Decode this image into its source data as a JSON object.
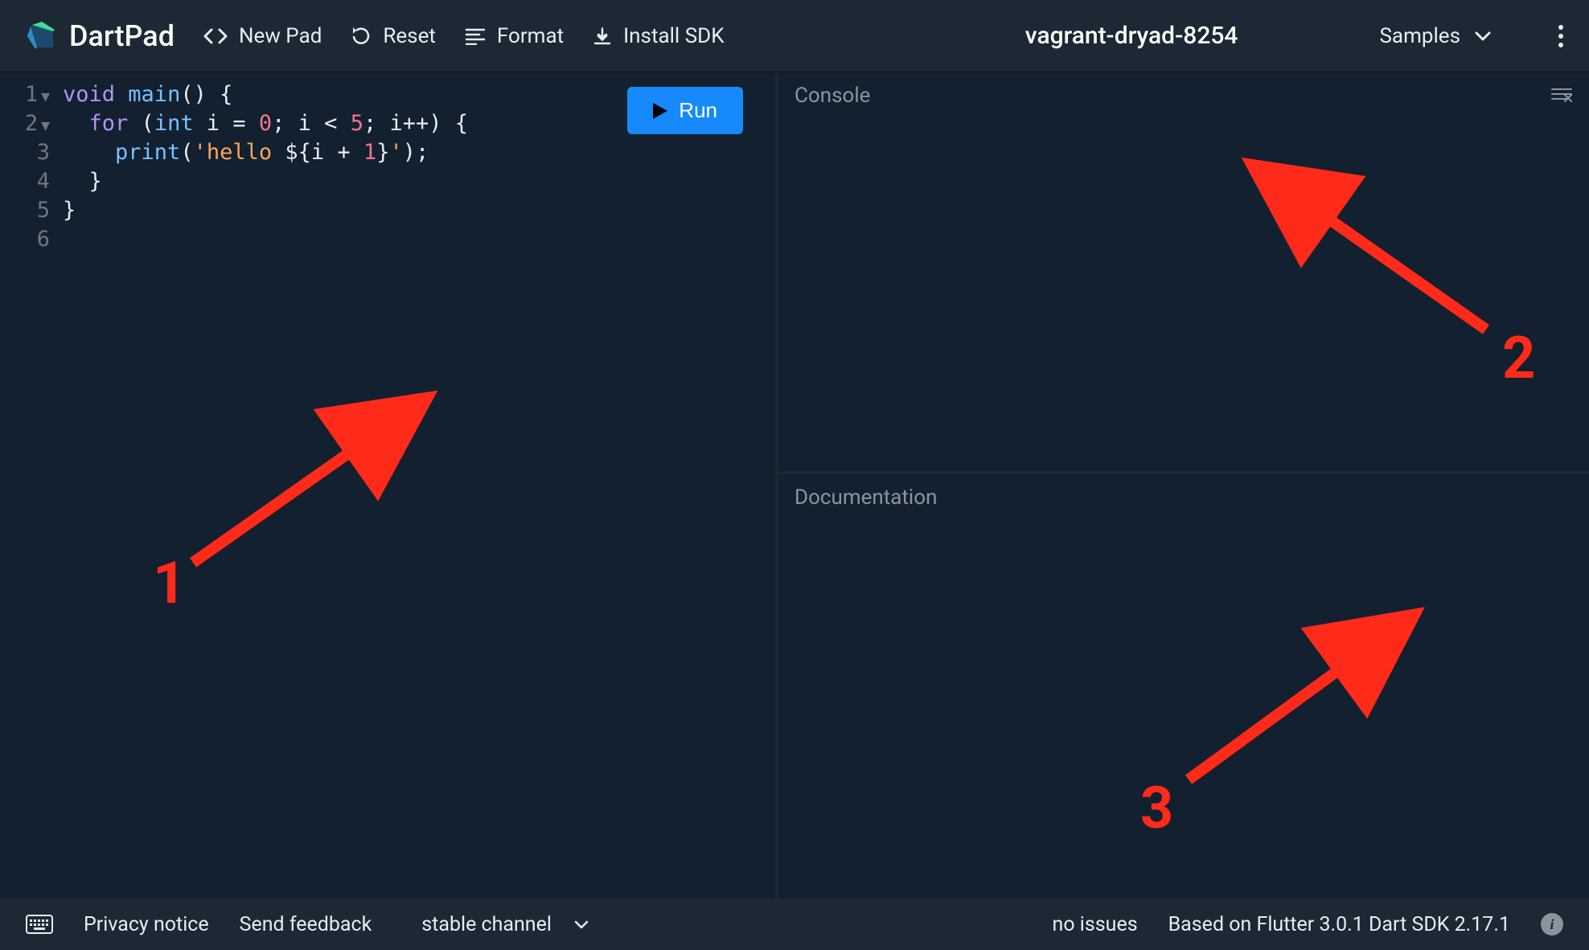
{
  "header": {
    "logo": "DartPad",
    "new_pad": "New Pad",
    "reset": "Reset",
    "format": "Format",
    "install_sdk": "Install SDK",
    "pad_name": "vagrant-dryad-8254",
    "samples": "Samples"
  },
  "editor": {
    "run_label": "Run",
    "line_numbers": [
      "1",
      "2",
      "3",
      "4",
      "5",
      "6"
    ],
    "code_tokens": [
      [
        [
          "void",
          "kw"
        ],
        [
          " ",
          "p"
        ],
        [
          "main",
          "fn"
        ],
        [
          "() {",
          "p"
        ]
      ],
      [
        [
          "  ",
          "p"
        ],
        [
          "for",
          "kw"
        ],
        [
          " (",
          "p"
        ],
        [
          "int",
          "type"
        ],
        [
          " i = ",
          "p"
        ],
        [
          "0",
          "num"
        ],
        [
          "; i < ",
          "p"
        ],
        [
          "5",
          "num"
        ],
        [
          "; i++) {",
          "p"
        ]
      ],
      [
        [
          "    ",
          "p"
        ],
        [
          "print",
          "fn"
        ],
        [
          "(",
          "p"
        ],
        [
          "'hello ",
          "str"
        ],
        [
          "${i + ",
          "p"
        ],
        [
          "1",
          "num"
        ],
        [
          "}",
          "p"
        ],
        [
          "'",
          "str"
        ],
        [
          ");",
          "p"
        ]
      ],
      [
        [
          "  }",
          "p"
        ]
      ],
      [
        [
          "}",
          "p"
        ]
      ],
      [
        [
          "",
          "p"
        ]
      ]
    ]
  },
  "panels": {
    "console_title": "Console",
    "docs_title": "Documentation"
  },
  "footer": {
    "privacy": "Privacy notice",
    "feedback": "Send feedback",
    "channel": "stable channel",
    "issues": "no issues",
    "version": "Based on Flutter 3.0.1 Dart SDK 2.17.1"
  },
  "annotations": {
    "one": "1",
    "two": "2",
    "three": "3"
  }
}
